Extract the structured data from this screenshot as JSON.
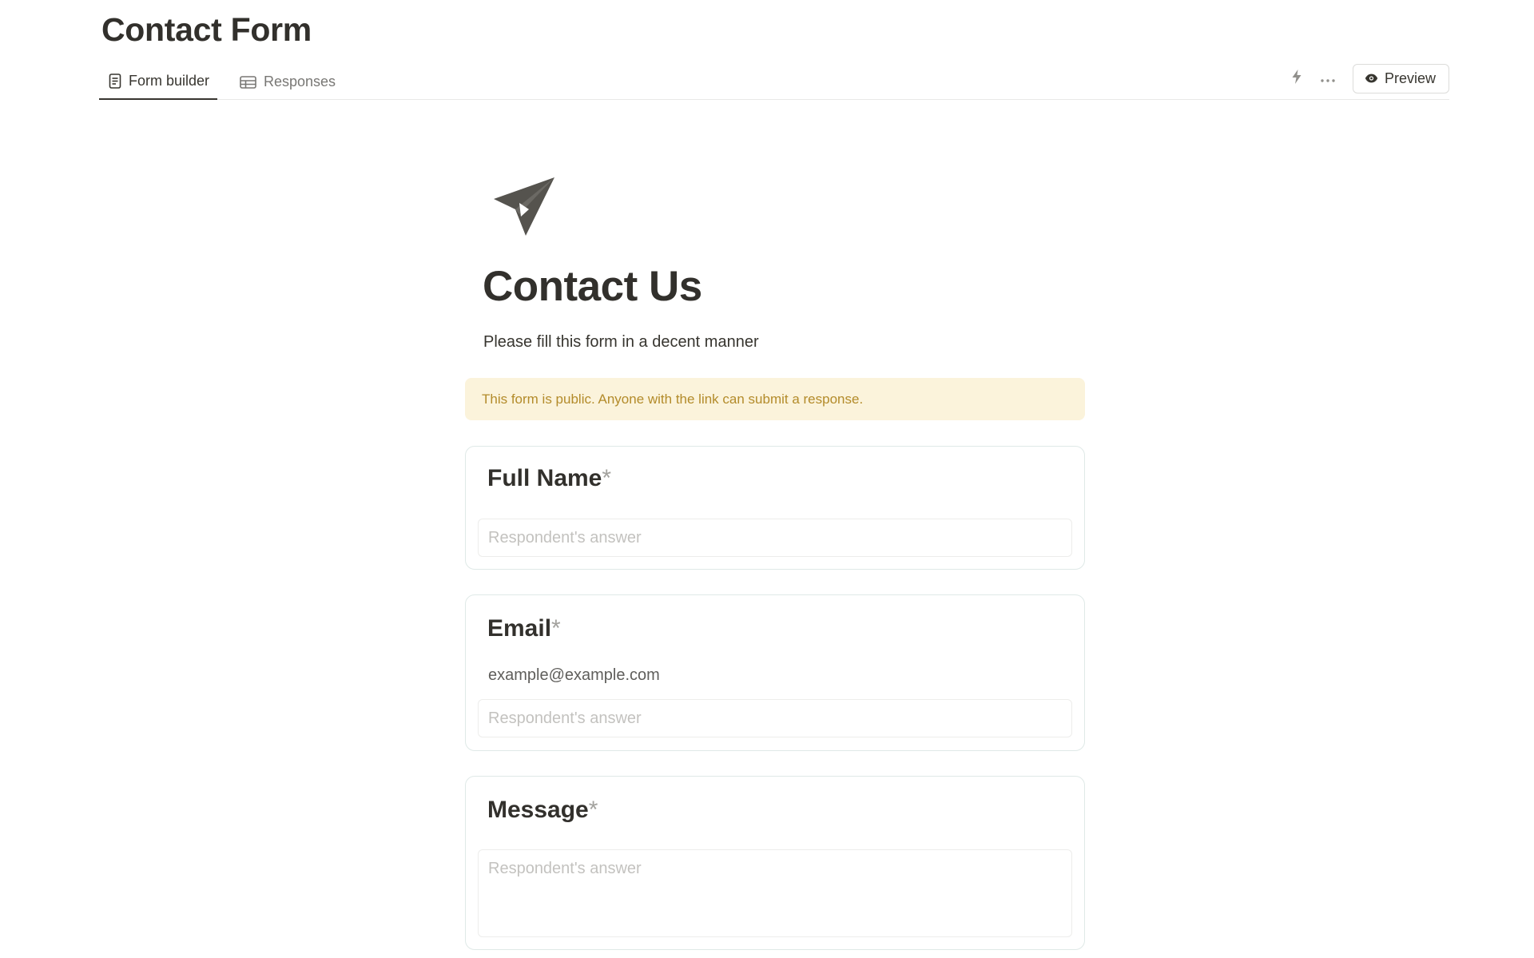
{
  "page": {
    "title": "Contact Form"
  },
  "tabs": [
    {
      "label": "Form builder",
      "icon": "document-icon",
      "active": true
    },
    {
      "label": "Responses",
      "icon": "table-icon",
      "active": false
    }
  ],
  "toolbar": {
    "automation_icon": "lightning-icon",
    "more_icon": "more-horizontal-icon",
    "preview_label": "Preview",
    "preview_icon": "eye-icon"
  },
  "form": {
    "icon": "paper-plane-icon",
    "title": "Contact Us",
    "description": "Please fill this form in a decent manner",
    "notice": "This form is public. Anyone with the link can submit a response.",
    "questions": [
      {
        "label": "Full Name",
        "required_mark": "*",
        "hint": "",
        "placeholder": "Respondent's answer"
      },
      {
        "label": "Email",
        "required_mark": "*",
        "hint": "example@example.com",
        "placeholder": "Respondent's answer"
      },
      {
        "label": "Message",
        "required_mark": "*",
        "hint": "",
        "placeholder": "Respondent's answer"
      }
    ]
  },
  "colors": {
    "text": "#37352f",
    "notice_bg": "#fbf3db",
    "notice_text": "#b38b2a",
    "card_border": "#dfe9e7"
  }
}
